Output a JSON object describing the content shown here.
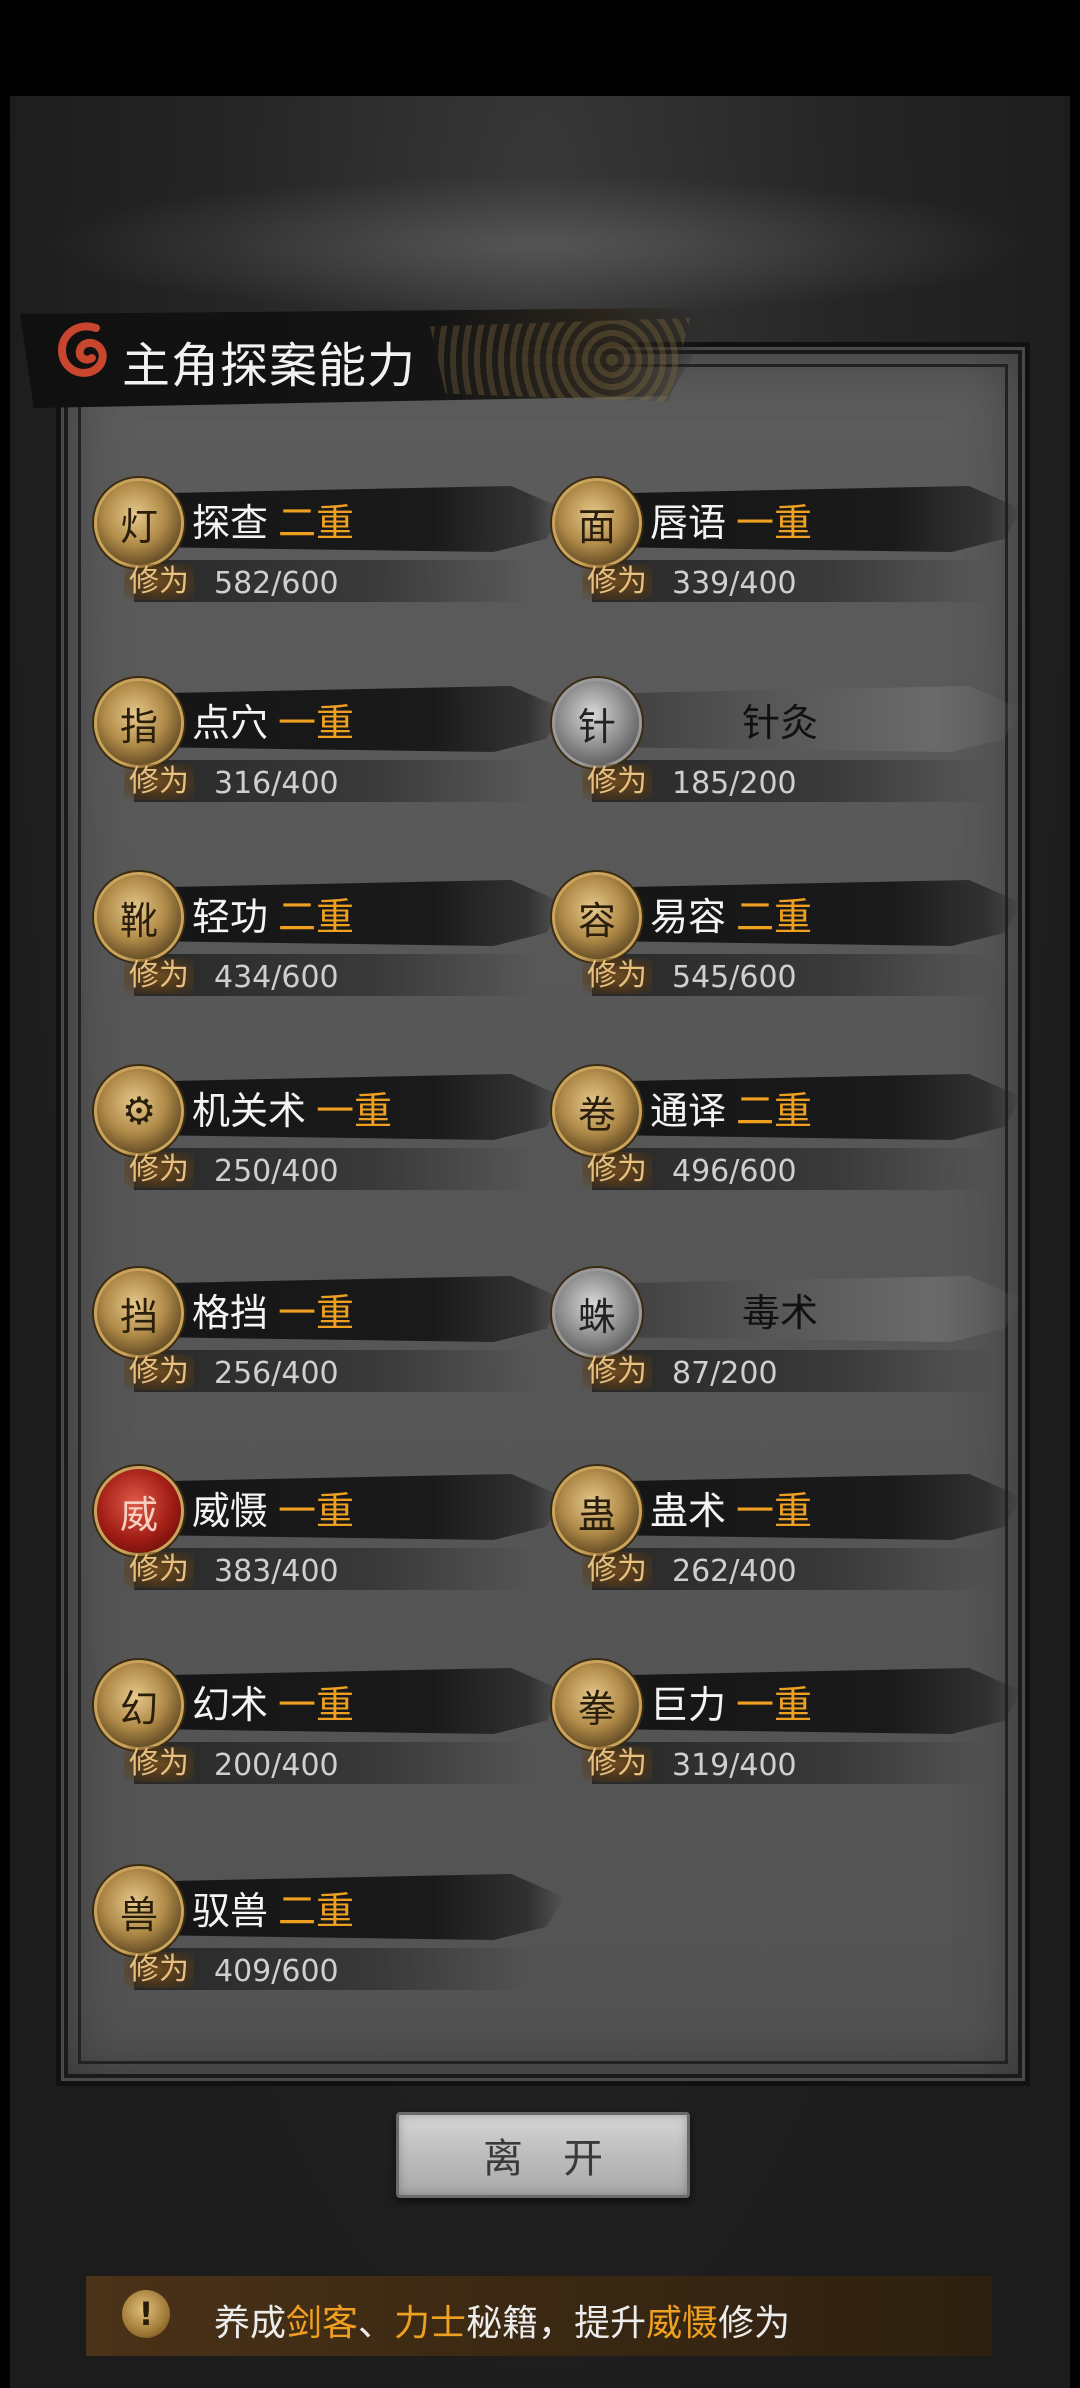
{
  "title": "主角探案能力",
  "xp_label": "修为",
  "skills": [
    {
      "name": "探查",
      "level": "二重",
      "xp": "582/600",
      "icon": "lantern-icon",
      "locked": false
    },
    {
      "name": "唇语",
      "level": "一重",
      "xp": "339/400",
      "icon": "face-icon",
      "locked": false
    },
    {
      "name": "点穴",
      "level": "一重",
      "xp": "316/400",
      "icon": "strike-icon",
      "locked": false
    },
    {
      "name": "针灸",
      "level": "",
      "xp": "185/200",
      "icon": "needle-icon",
      "locked": true
    },
    {
      "name": "轻功",
      "level": "二重",
      "xp": "434/600",
      "icon": "boot-icon",
      "locked": false
    },
    {
      "name": "易容",
      "level": "二重",
      "xp": "545/600",
      "icon": "mask-icon",
      "locked": false
    },
    {
      "name": "机关术",
      "level": "一重",
      "xp": "250/400",
      "icon": "gear-icon",
      "locked": false
    },
    {
      "name": "通译",
      "level": "二重",
      "xp": "496/600",
      "icon": "scroll-icon",
      "locked": false
    },
    {
      "name": "格挡",
      "level": "一重",
      "xp": "256/400",
      "icon": "block-icon",
      "locked": false
    },
    {
      "name": "毒术",
      "level": "",
      "xp": "87/200",
      "icon": "spider-icon",
      "locked": true
    },
    {
      "name": "威慑",
      "level": "一重",
      "xp": "383/400",
      "icon": "intimidate-icon",
      "locked": false
    },
    {
      "name": "蛊术",
      "level": "一重",
      "xp": "262/400",
      "icon": "worm-icon",
      "locked": false
    },
    {
      "name": "幻术",
      "level": "一重",
      "xp": "200/400",
      "icon": "hooded-figure-icon",
      "locked": false
    },
    {
      "name": "巨力",
      "level": "一重",
      "xp": "319/400",
      "icon": "fist-icon",
      "locked": false
    },
    {
      "name": "驭兽",
      "level": "二重",
      "xp": "409/600",
      "icon": "wolf-icon",
      "locked": false
    }
  ],
  "leave_button": "离开",
  "tip": {
    "p1": "养成",
    "h1": "剑客",
    "p2": "、",
    "h2": "力士",
    "p3": "秘籍，提升",
    "h3": "威慑",
    "p4": "修为"
  },
  "colors": {
    "level_accent": "#f0a020",
    "panel": "#575757",
    "title_bar": "#141414"
  }
}
